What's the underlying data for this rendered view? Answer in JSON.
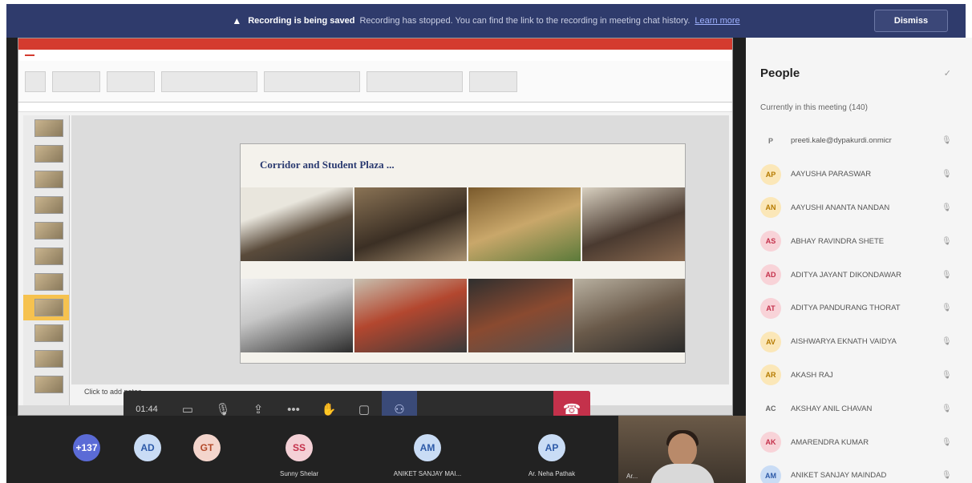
{
  "banner": {
    "title": "Recording is being saved",
    "message": "Recording has stopped. You can find the link to the recording in meeting chat history.",
    "link": "Learn more",
    "dismiss": "Dismiss"
  },
  "slide": {
    "title": "Corridor and Student Plaza ...",
    "notes_placeholder": "Click to add notes"
  },
  "controls": {
    "timer": "01:44"
  },
  "participants": [
    {
      "initials": "+137",
      "name": "",
      "color": "#5b6bd6",
      "text": "#fff"
    },
    {
      "initials": "AD",
      "name": "",
      "color": "#c9dcf5",
      "text": "#2d5aa8"
    },
    {
      "initials": "GT",
      "name": "",
      "color": "#f4d5cc",
      "text": "#b34a2a"
    },
    {
      "initials": "SS",
      "name": "Sunny Shelar",
      "color": "#f4d0d6",
      "text": "#c4314b"
    },
    {
      "initials": "AM",
      "name": "ANIKET SANJAY MAI...",
      "color": "#c9dcf5",
      "text": "#2d5aa8"
    },
    {
      "initials": "AP",
      "name": "Ar. Neha Pathak",
      "color": "#c9dcf5",
      "text": "#2d5aa8"
    }
  ],
  "video_tile": {
    "name": "Ar..."
  },
  "people_panel": {
    "title": "People",
    "subtitle": "Currently in this meeting (140)",
    "members": [
      {
        "initials": "P",
        "name": "preeti.kale@dypakurdi.onmicr",
        "bg": "#f5f5f5",
        "fg": "#777"
      },
      {
        "initials": "AP",
        "name": "AAYUSHA PARASWAR",
        "bg": "#fbe7b8",
        "fg": "#b57a00"
      },
      {
        "initials": "AN",
        "name": "AAYUSHI ANANTA NANDAN",
        "bg": "#fbe7b8",
        "fg": "#b57a00"
      },
      {
        "initials": "AS",
        "name": "ABHAY RAVINDRA SHETE",
        "bg": "#f8d3d8",
        "fg": "#c4314b"
      },
      {
        "initials": "AD",
        "name": "ADITYA JAYANT DIKONDAWAR",
        "bg": "#f8d3d8",
        "fg": "#c4314b"
      },
      {
        "initials": "AT",
        "name": "ADITYA PANDURANG THORAT",
        "bg": "#f8d3d8",
        "fg": "#c4314b"
      },
      {
        "initials": "AV",
        "name": "AISHWARYA EKNATH VAIDYA",
        "bg": "#fbe7b8",
        "fg": "#b57a00"
      },
      {
        "initials": "AR",
        "name": "AKASH RAJ",
        "bg": "#fbe7b8",
        "fg": "#b57a00"
      },
      {
        "initials": "AC",
        "name": "AKSHAY ANIL CHAVAN",
        "bg": "#f5f5f5",
        "fg": "#666"
      },
      {
        "initials": "AK",
        "name": "AMARENDRA KUMAR",
        "bg": "#f8d3d8",
        "fg": "#c4314b"
      },
      {
        "initials": "AM",
        "name": "ANIKET SANJAY MAINDAD",
        "bg": "#c9dcf5",
        "fg": "#2d5aa8"
      }
    ]
  }
}
